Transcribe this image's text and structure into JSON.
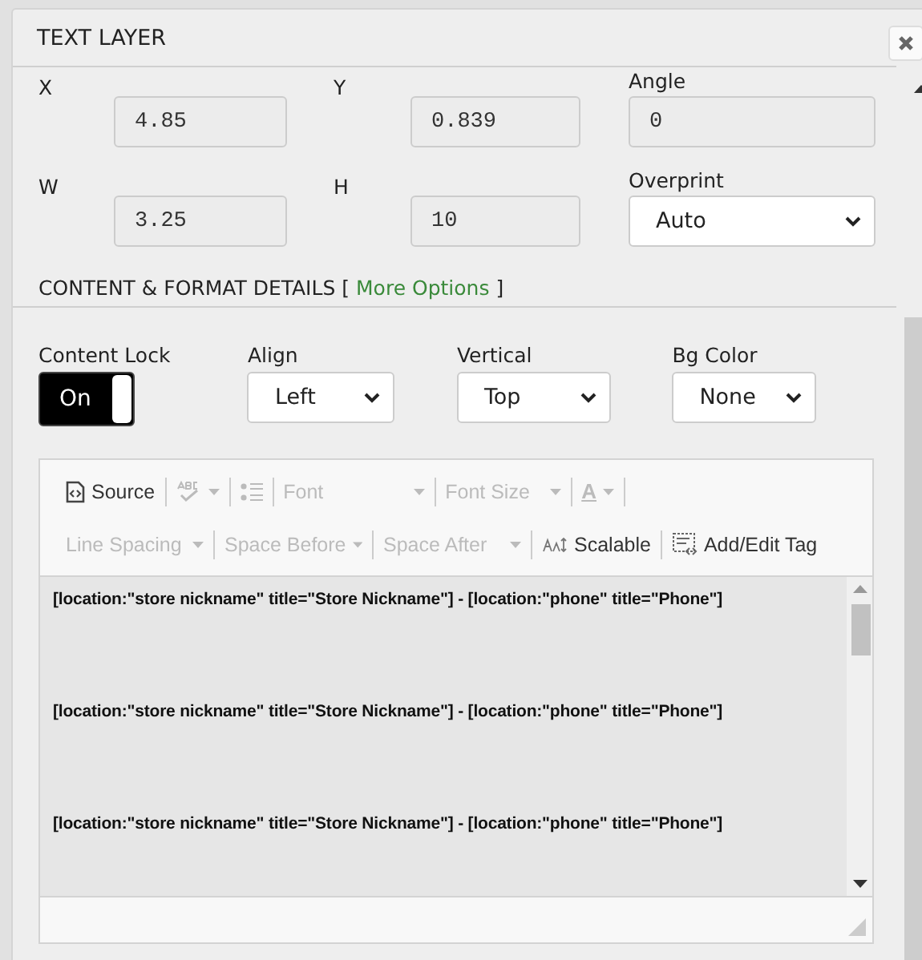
{
  "window": {
    "title": "TEXT LAYER"
  },
  "geometry": [
    {
      "label": "X",
      "value": "4.85"
    },
    {
      "label": "Y",
      "value": "0.839"
    },
    {
      "label": "Angle",
      "value": "0"
    },
    {
      "label": "W",
      "value": "3.25"
    },
    {
      "label": "H",
      "value": "10"
    }
  ],
  "overprint": {
    "label": "Overprint",
    "value": "Auto"
  },
  "section": {
    "title": "CONTENT & FORMAT DETAILS",
    "open_bracket": "[",
    "link": "More Options",
    "close_bracket": "]"
  },
  "content_lock": {
    "label": "Content Lock",
    "state_text": "On",
    "on": true
  },
  "selects": [
    {
      "label": "Align",
      "value": "Left"
    },
    {
      "label": "Vertical",
      "value": "Top"
    },
    {
      "label": "Bg Color",
      "value": "None"
    }
  ],
  "toolbar": {
    "top": [
      {
        "label": "Source",
        "disabled": false,
        "dropdown": false
      },
      {
        "disabled": true,
        "dropdown": true
      },
      {
        "disabled": true,
        "dropdown": false
      },
      {
        "label": "Font",
        "disabled": true,
        "dropdown": true
      },
      {
        "label": "Font Size",
        "disabled": true,
        "dropdown": true
      },
      {
        "label": "A",
        "disabled": true,
        "dropdown": true
      }
    ],
    "bottom": [
      {
        "label": "Line Spacing",
        "disabled": true,
        "dropdown": true
      },
      {
        "label": "Space Before",
        "disabled": true,
        "dropdown": true
      },
      {
        "label": "Space After",
        "disabled": true,
        "dropdown": true
      },
      {
        "label": "Scalable",
        "disabled": false,
        "dropdown": false
      },
      {
        "label": "Add/Edit Tag",
        "disabled": false,
        "dropdown": false
      }
    ]
  },
  "content": [
    "[location:\"store nickname\" title=\"Store Nickname\"] - [location:\"phone\" title=\"Phone\"]",
    "[location:\"store nickname\" title=\"Store Nickname\"] - [location:\"phone\" title=\"Phone\"]",
    "[location:\"store nickname\" title=\"Store Nickname\"] - [location:\"phone\" title=\"Phone\"]"
  ]
}
